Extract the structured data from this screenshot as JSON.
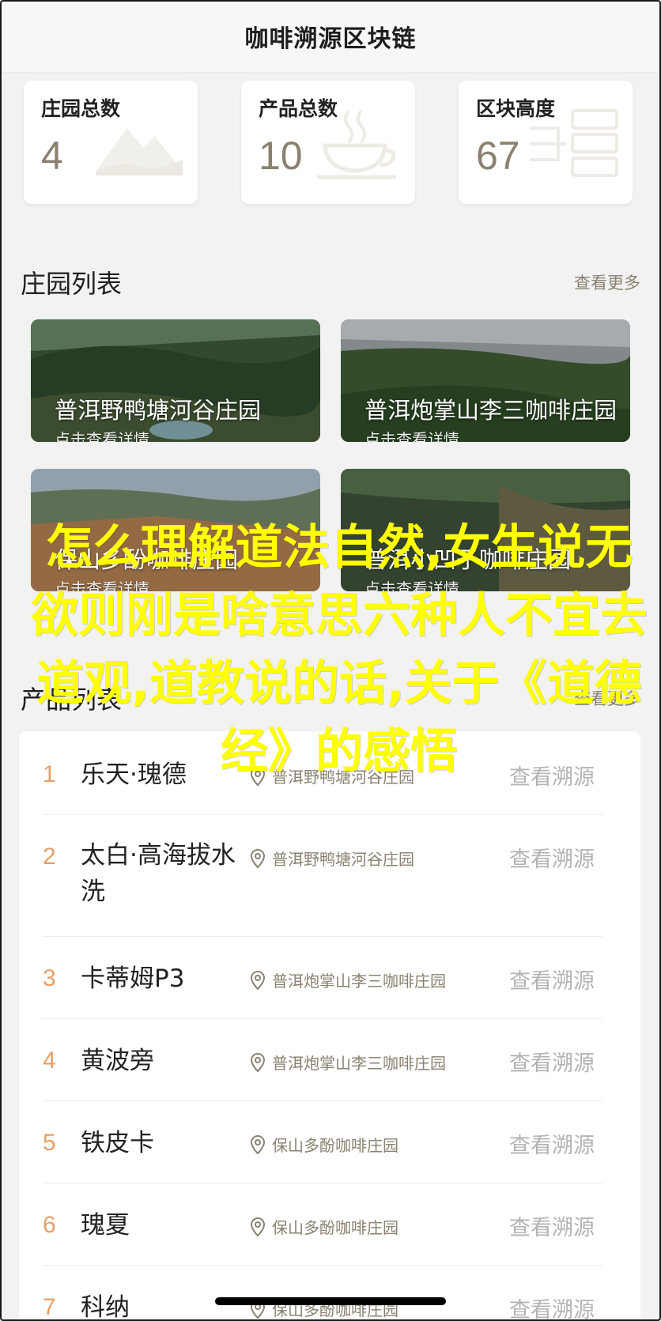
{
  "navbar": {
    "title": "咖啡溯源区块链"
  },
  "stats": [
    {
      "label": "庄园总数",
      "value": "4",
      "icon": "mountain-icon"
    },
    {
      "label": "产品总数",
      "value": "10",
      "icon": "coffee-cup-icon"
    },
    {
      "label": "区块高度",
      "value": "67",
      "icon": "server-blocks-icon"
    }
  ],
  "farm_section": {
    "title": "庄园列表",
    "more": "查看更多"
  },
  "farms": [
    {
      "name": "普洱野鸭塘河谷庄园",
      "sub": "点击查看详情"
    },
    {
      "name": "普洱炮掌山李三咖啡庄园",
      "sub": "点击查看详情"
    },
    {
      "name": "保山多酚咖啡庄园",
      "sub": "点击查看详情"
    },
    {
      "name": "普洱小凹子咖啡庄园",
      "sub": "点击查看详情"
    }
  ],
  "product_section": {
    "title": "产品列表",
    "more": "查看更多"
  },
  "products": [
    {
      "index": "1",
      "name": "乐天·瑰德",
      "location": "普洱野鸭塘河谷庄园",
      "action": "查看溯源"
    },
    {
      "index": "2",
      "name": "太白·高海拔水洗",
      "location": "普洱野鸭塘河谷庄园",
      "action": "查看溯源"
    },
    {
      "index": "3",
      "name": "卡蒂姆P3",
      "location": "普洱炮掌山李三咖啡庄园",
      "action": "查看溯源"
    },
    {
      "index": "4",
      "name": "黄波旁",
      "location": "普洱炮掌山李三咖啡庄园",
      "action": "查看溯源"
    },
    {
      "index": "5",
      "name": "铁皮卡",
      "location": "保山多酚咖啡庄园",
      "action": "查看溯源"
    },
    {
      "index": "6",
      "name": "瑰夏",
      "location": "保山多酚咖啡庄园",
      "action": "查看溯源"
    },
    {
      "index": "7",
      "name": "科纳",
      "location": "保山多酚咖啡庄园",
      "action": "查看溯源"
    }
  ],
  "overlay_text": "怎么理解道法自然,女生说无欲则刚是啥意思六种人不宜去道观,道教说的话,关于《道德经》的感悟",
  "colors": {
    "accent": "#8a8170",
    "index": "#e3a06a",
    "overlay": "#ffff00"
  }
}
